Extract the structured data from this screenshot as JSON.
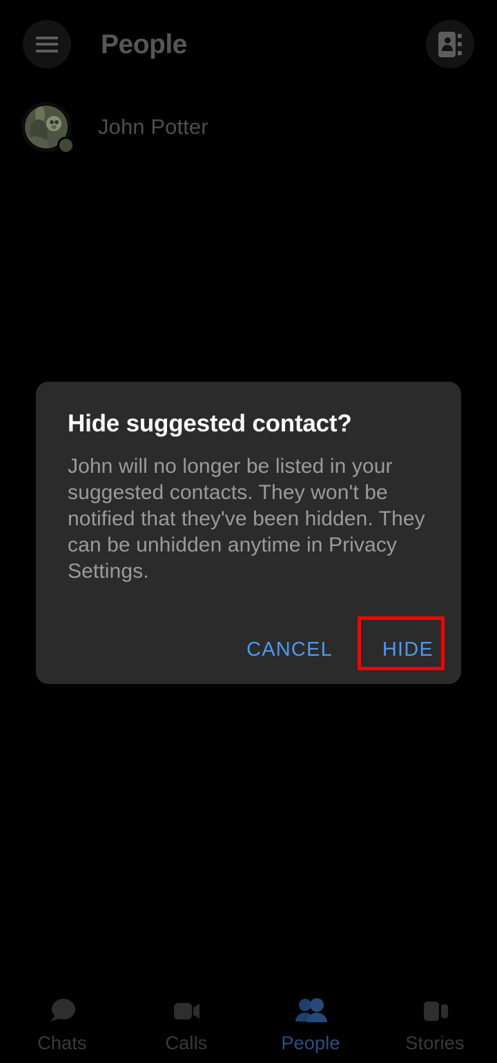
{
  "app": {
    "title": "People"
  },
  "colors": {
    "background": "#000000",
    "dialog_background": "#2b2b2b",
    "accent_blue": "#4a9af2",
    "active_tab_blue": "#2a4f80",
    "highlight_red": "#ff0000",
    "title_gray": "#565656",
    "body_gray": "#9b9b9b",
    "online_status_green": "#3f4a35"
  },
  "app_bar": {
    "menu_icon": "hamburger-menu-icon",
    "title": "People",
    "contacts_icon": "address-book-icon"
  },
  "contact_row": {
    "avatar_icon": "user-avatar",
    "name": "John Potter",
    "status_icon": "online-status-dot"
  },
  "dialog": {
    "title": "Hide suggested contact?",
    "body": "John will no longer be listed in your suggested contacts. They won't be notified that they've been hidden. They can be unhidden anytime in Privacy Settings.",
    "cancel_label": "CANCEL",
    "hide_label": "HIDE"
  },
  "bottom_nav": {
    "items": [
      {
        "label": "Chats",
        "icon": "chat-bubble-icon",
        "active": false
      },
      {
        "label": "Calls",
        "icon": "video-camera-icon",
        "active": false
      },
      {
        "label": "People",
        "icon": "people-icon",
        "active": true
      },
      {
        "label": "Stories",
        "icon": "stories-panels-icon",
        "active": false
      }
    ]
  }
}
